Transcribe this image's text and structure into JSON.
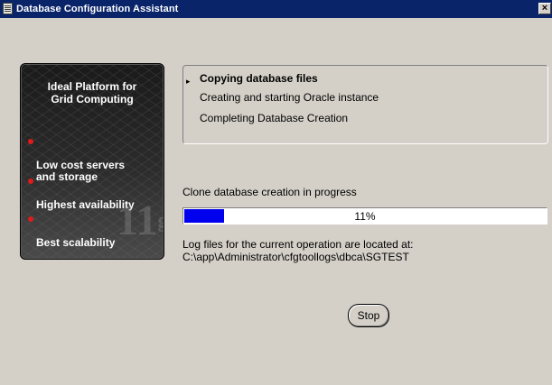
{
  "window": {
    "title": "Database Configuration Assistant",
    "close_glyph": "×"
  },
  "branding": {
    "title": "Ideal Platform for\nGrid Computing",
    "features": [
      "Low cost servers\nand storage",
      "Highest availability",
      "Best scalability"
    ],
    "bullet_color": "#e01b1b",
    "logo_watermark": "11",
    "logo_watermark_sup": "g"
  },
  "steps": [
    {
      "label": "Copying database files",
      "active": true
    },
    {
      "label": "Creating and starting Oracle instance",
      "active": false
    },
    {
      "label": "Completing Database Creation",
      "active": false
    }
  ],
  "status": {
    "message": "Clone database creation in progress",
    "progress_percent": 11,
    "progress_label": "11%",
    "progress_color": "#0000ee"
  },
  "log": {
    "label": "Log files for the current operation are located at:",
    "path": "C:\\app\\Administrator\\cfgtoollogs\\dbca\\SGTEST"
  },
  "buttons": {
    "stop_label": "Stop"
  }
}
